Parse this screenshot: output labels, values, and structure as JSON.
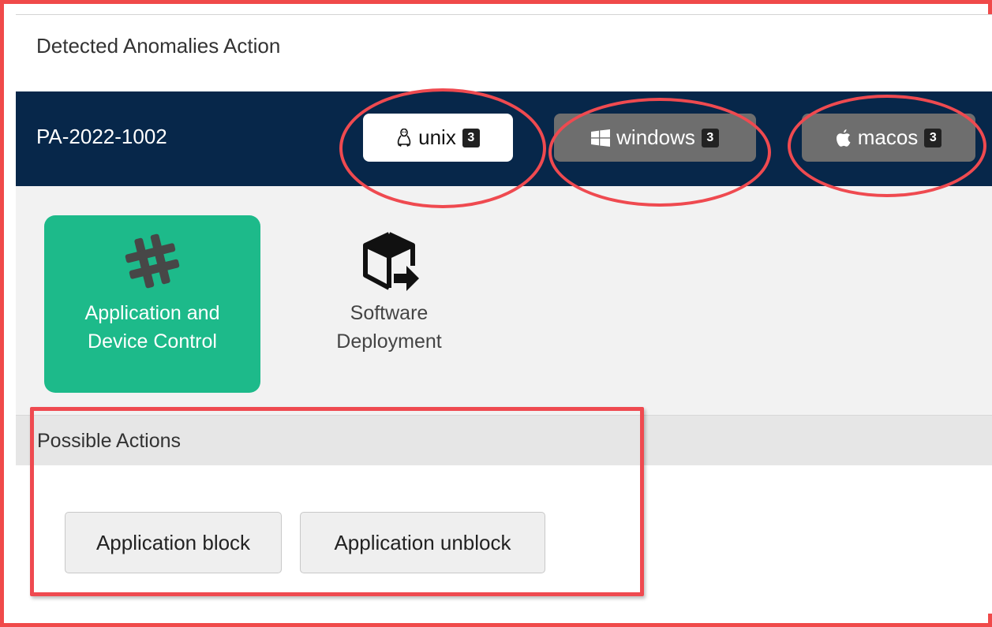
{
  "panel": {
    "title": "Detected Anomalies Action"
  },
  "navbar": {
    "patch_id": "PA-2022-1002",
    "os_tabs": [
      {
        "label": "unix",
        "count": "3",
        "icon": "linux-penguin-icon",
        "active": true
      },
      {
        "label": "windows",
        "count": "3",
        "icon": "windows-logo-icon",
        "active": false
      },
      {
        "label": "macos",
        "count": "3",
        "icon": "apple-logo-icon",
        "active": false
      }
    ]
  },
  "categories": [
    {
      "label_line1": "Application and",
      "label_line2": "Device Control",
      "icon": "hashtag-icon",
      "active": true
    },
    {
      "label_line1": "Software",
      "label_line2": "Deployment",
      "icon": "box-arrow-icon",
      "active": false
    }
  ],
  "actions": {
    "header": "Possible Actions",
    "buttons": [
      {
        "label": "Application block"
      },
      {
        "label": "Application unblock"
      }
    ]
  },
  "colors": {
    "navbar_bg": "#07274a",
    "active_tile": "#1dba8a",
    "highlight_red": "#ef4a50",
    "badge_bg": "#222222"
  }
}
